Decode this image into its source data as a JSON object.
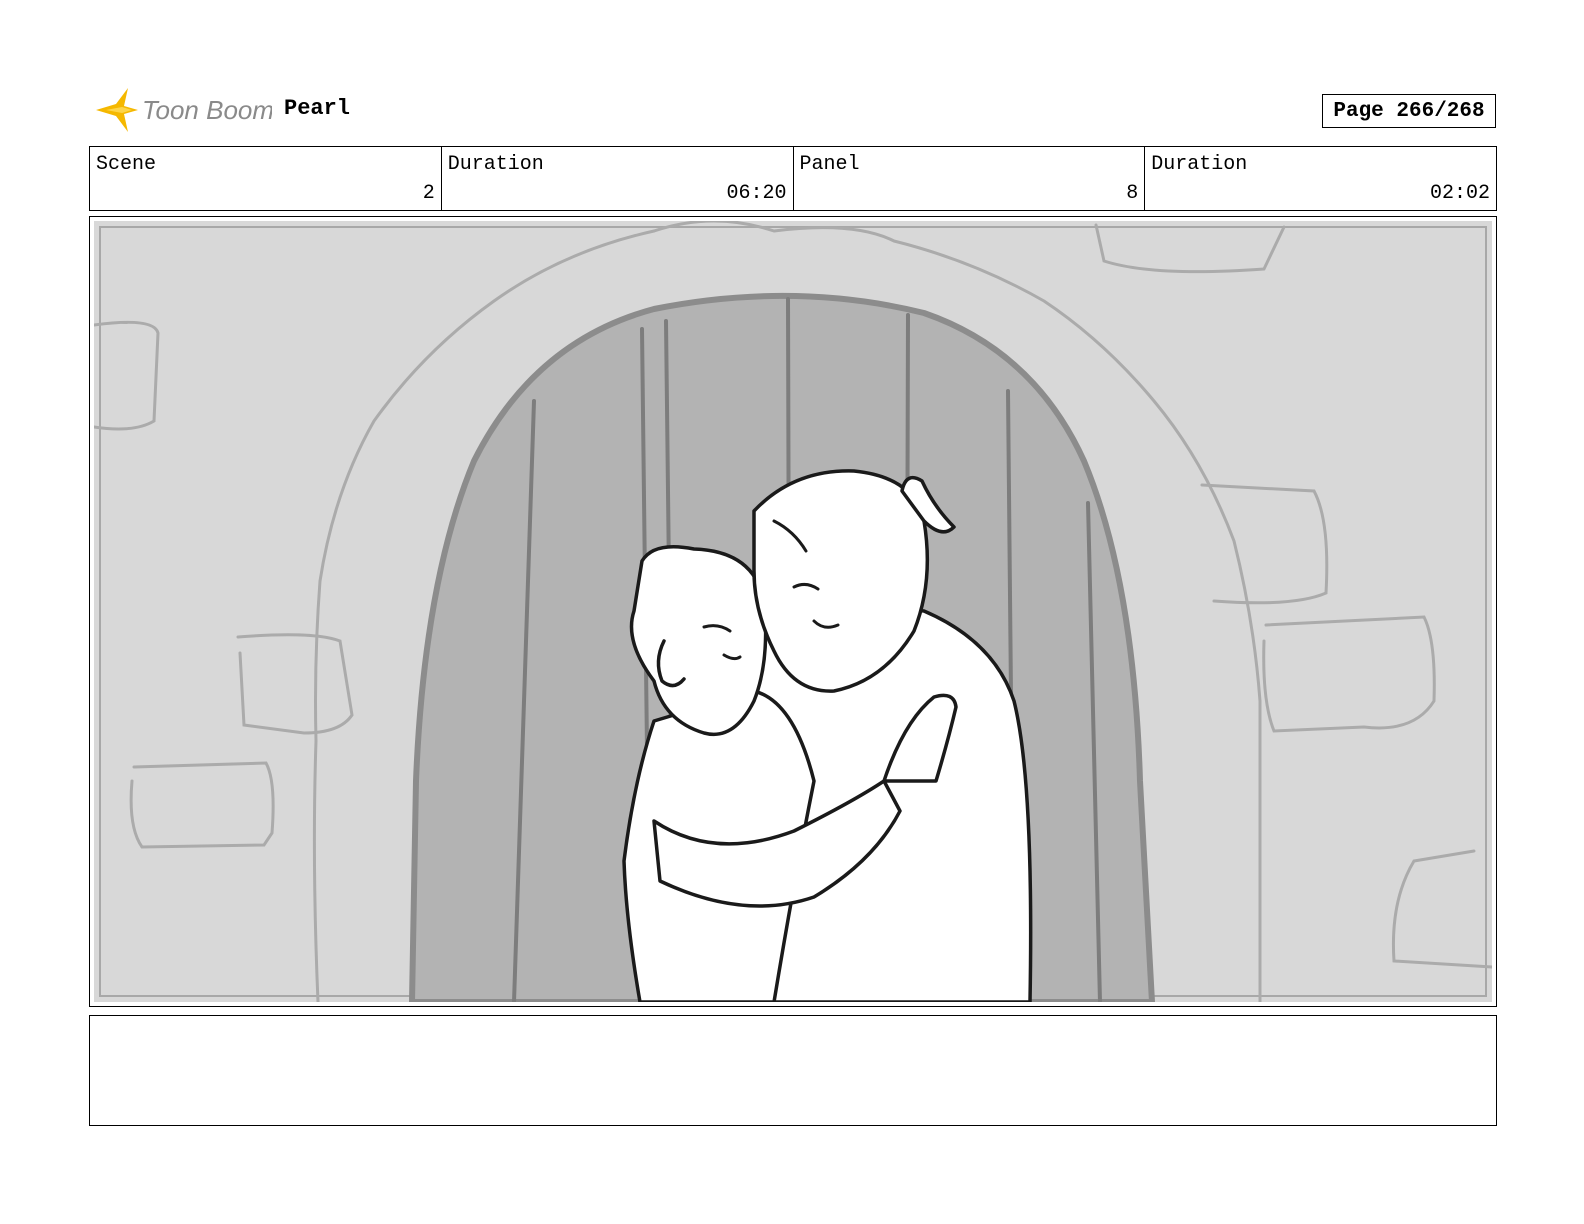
{
  "header": {
    "logo_text": "Toon Boom",
    "project_title": "Pearl",
    "page_label": "Page 266/268"
  },
  "info": [
    {
      "label": "Scene",
      "value": "2"
    },
    {
      "label": "Duration",
      "value": "06:20"
    },
    {
      "label": "Panel",
      "value": "8"
    },
    {
      "label": "Duration",
      "value": "02:02"
    }
  ],
  "panel": {
    "image_description": "Sketch of two characters embracing in front of an arched wooden door in a stone wall"
  },
  "notes": {
    "text": ""
  },
  "colors": {
    "logo_accent": "#f5b800",
    "logo_text": "#8a8a8a",
    "wall": "#d8d8d8",
    "door": "#b3b3b3"
  }
}
